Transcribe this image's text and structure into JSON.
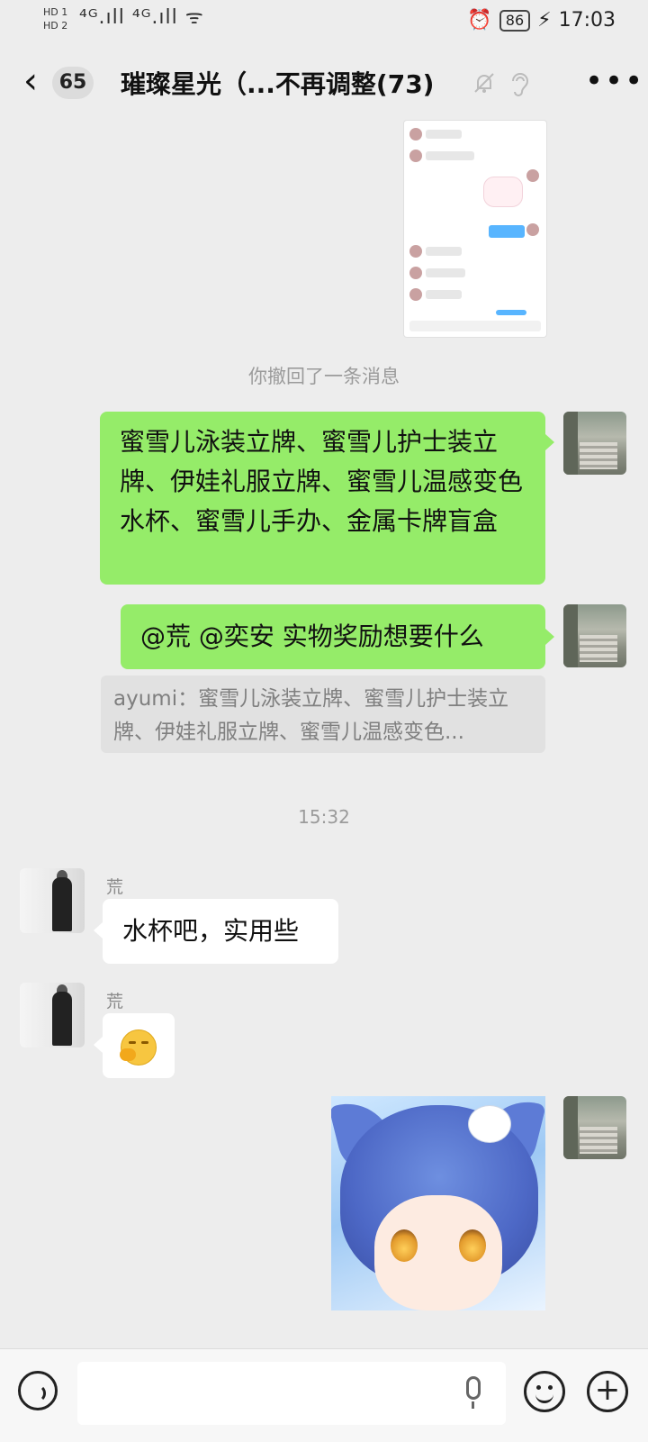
{
  "status_bar": {
    "hd1": "HD 1",
    "hd2": "HD 2",
    "network": "⁴ᴳ.ıll ⁴ᴳ.ıll ᯤ",
    "alarm": "⏰",
    "battery": "86",
    "time": "17:03"
  },
  "header": {
    "unread_count": "65",
    "title": "璀璨星光（...不再调整(73)"
  },
  "messages": {
    "recalled_notice": "你撤回了一条消息",
    "self_msg_1": "蜜雪儿泳装立牌、蜜雪儿护士装立牌、伊娃礼服立牌、蜜雪儿温感变色水杯、蜜雪儿手办、金属卡牌盲盒",
    "self_msg_2": "@荒  @奕安  实物奖励想要什么",
    "quote_text": "ayumi：蜜雪儿泳装立牌、蜜雪儿护士装立牌、伊娃礼服立牌、蜜雪儿温感变色...",
    "timestamp": "15:32",
    "other_sender_1": "荒",
    "other_msg_1": "水杯吧，实用些",
    "other_sender_2": "荒"
  },
  "icons": {
    "back": "chevron-left-icon",
    "mute": "bell-off-icon",
    "ear": "ear-icon",
    "more": "more-icon",
    "voice": "voice-icon",
    "mic": "mic-icon",
    "emoji": "emoji-icon",
    "plus": "plus-icon"
  },
  "colors": {
    "self_bubble": "#95ec69",
    "other_bubble": "#ffffff",
    "background": "#ededed"
  }
}
